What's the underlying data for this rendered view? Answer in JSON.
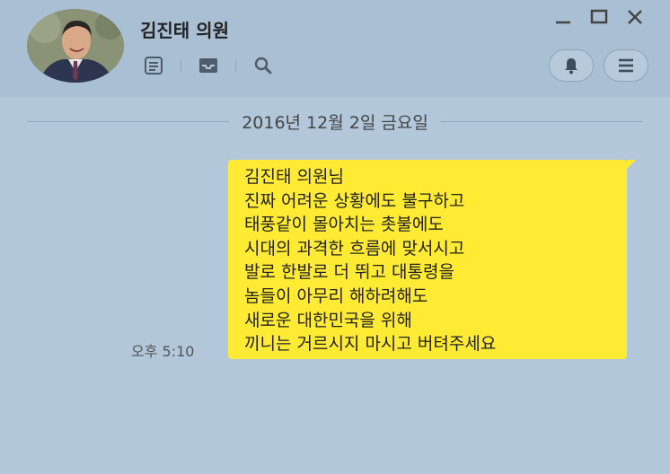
{
  "header": {
    "title": "김진태 의원"
  },
  "chat": {
    "date": "2016년 12월 2일 금요일",
    "message": {
      "time": "오후 5:10",
      "lines": [
        "김진태 의원님",
        "진짜 어려운 상황에도 불구하고",
        "태풍같이 몰아치는 촛불에도",
        "시대의 과격한 흐름에 맞서시고",
        "발로 한발로 더 뛰고 대통령을",
        "놈들이 아무리 해하려해도",
        "새로운 대한민국을 위해",
        "끼니는 거르시지 마시고 버텨주세요"
      ]
    }
  },
  "colors": {
    "background": "#b2c7da",
    "header": "#a9bfd3",
    "bubble": "#ffeb33"
  },
  "icons": [
    "notes-icon",
    "inbox-icon",
    "search-icon",
    "minimize-icon",
    "maximize-icon",
    "close-icon",
    "bell-icon",
    "menu-icon"
  ]
}
